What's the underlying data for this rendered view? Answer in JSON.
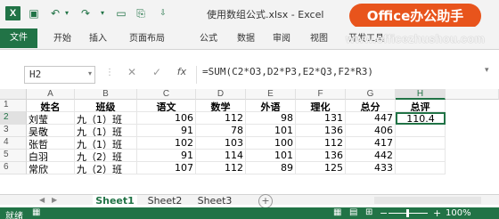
{
  "window": {
    "title": "使用数组公式.xlsx - Excel",
    "brand_badge": "Office办公助手",
    "brand_url": "www.officezhushou.com"
  },
  "ribbon": {
    "file": "文件",
    "tabs": [
      "开始",
      "插入",
      "页面布局",
      "公式",
      "数据",
      "审阅",
      "视图",
      "开发工具"
    ]
  },
  "formula_bar": {
    "cell_ref": "H2",
    "cancel": "✕",
    "enter": "✓",
    "fx": "fx",
    "formula": "=SUM(C2*O3,D2*P3,E2*Q3,F2*R3)"
  },
  "columns": [
    "A",
    "B",
    "C",
    "D",
    "E",
    "F",
    "G",
    "H"
  ],
  "rows": [
    "1",
    "2",
    "3",
    "4",
    "5",
    "6"
  ],
  "table": {
    "headers": [
      "姓名",
      "班级",
      "语文",
      "数学",
      "外语",
      "理化",
      "总分",
      "总评"
    ],
    "data": [
      [
        "刘莹",
        "九（1）班",
        "106",
        "112",
        "98",
        "131",
        "447",
        "110.4"
      ],
      [
        "吴敬",
        "九（1）班",
        "91",
        "78",
        "101",
        "136",
        "406",
        ""
      ],
      [
        "张哲",
        "九（1）班",
        "102",
        "103",
        "100",
        "112",
        "417",
        ""
      ],
      [
        "白羽",
        "九（2）班",
        "91",
        "114",
        "101",
        "136",
        "442",
        ""
      ],
      [
        "常欣",
        "九（2）班",
        "107",
        "112",
        "89",
        "125",
        "433",
        ""
      ]
    ]
  },
  "sheets": [
    "Sheet1",
    "Sheet2",
    "Sheet3"
  ],
  "active_sheet": "Sheet1",
  "status": {
    "text": "就绪",
    "zoom": "100%",
    "zoom_minus": "−",
    "zoom_plus": "+"
  },
  "accent_color": "#217346",
  "brand_color": "#e8541c"
}
